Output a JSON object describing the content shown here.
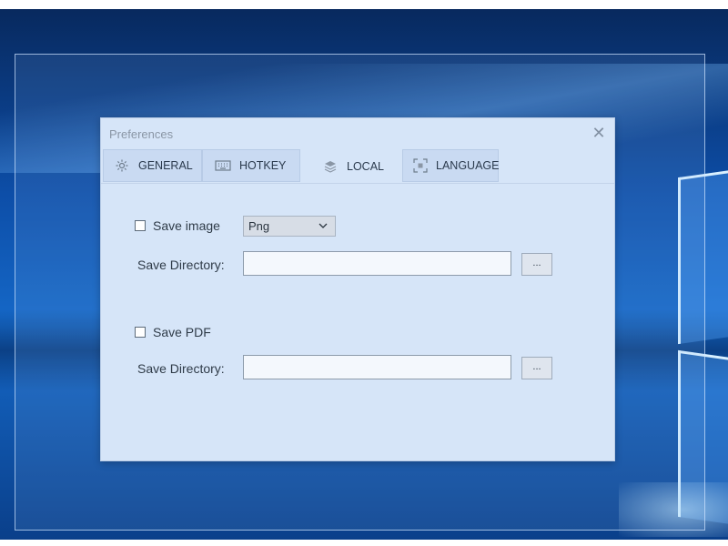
{
  "dialog": {
    "title": "Preferences",
    "close_glyph": "✕"
  },
  "tabs": [
    {
      "label": "GENERAL",
      "icon": "gear-icon",
      "active": false
    },
    {
      "label": "HOTKEY",
      "icon": "keyboard-icon",
      "active": false
    },
    {
      "label": "LOCAL",
      "icon": "layers-icon",
      "active": true
    },
    {
      "label": "LANGUAGE",
      "icon": "language-icon",
      "active": false
    }
  ],
  "image_section": {
    "checkbox_label": "Save image",
    "checked": false,
    "format_value": "Png",
    "directory_label": "Save Directory:",
    "directory_value": "",
    "browse_label": "..."
  },
  "pdf_section": {
    "checkbox_label": "Save PDF",
    "checked": false,
    "directory_label": "Save Directory:",
    "directory_value": "",
    "browse_label": "..."
  },
  "colors": {
    "dialog_bg": "#d6e5f8",
    "tab_bg": "#c9daf2",
    "desktop_blue": "#0d4ea8"
  }
}
